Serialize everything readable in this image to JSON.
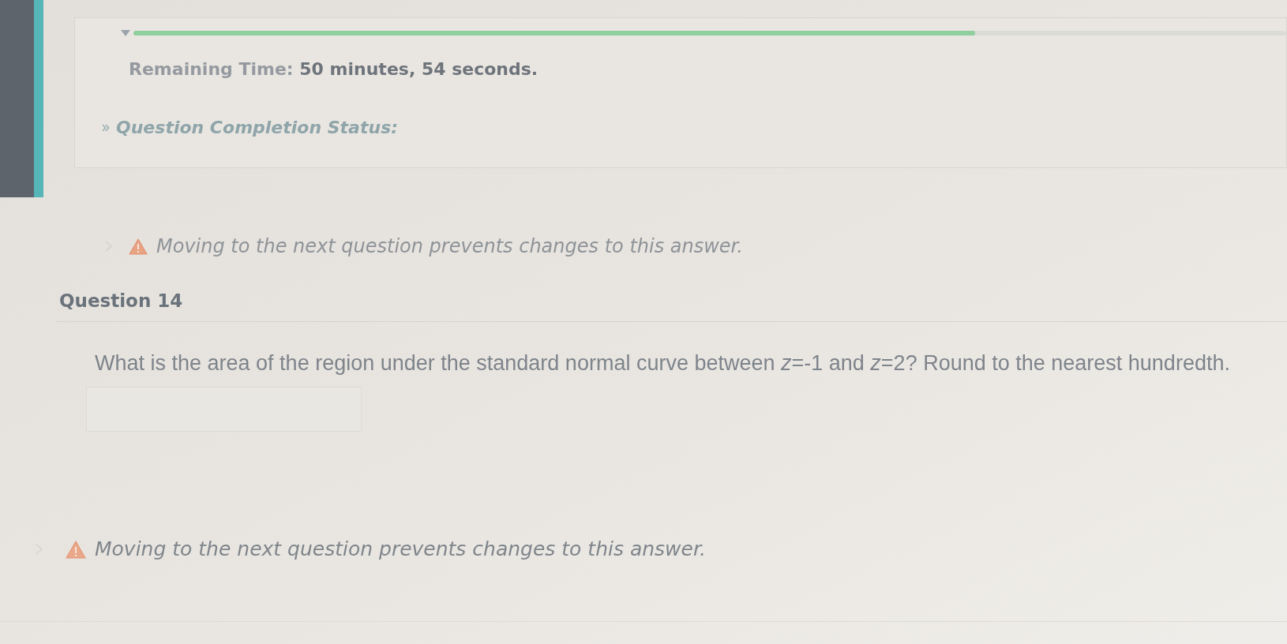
{
  "timer_panel": {
    "progress": {
      "level": 0.73
    },
    "remaining_time": "Remaining Time: **50 minutes, 54 seconds.**",
    "completion_status": "Question Completion Status:"
  },
  "warning_above": {
    "text": "Moving to the next question prevents changes to this answer."
  },
  "question": {
    "title": "Question 14",
    "text": "What is the area of the region under the standard normal curve between *z*=-1 and *z*=2? Round to the nearest hundredth."
  },
  "warning_below": {
    "text": "Moving to the next question prevents changes to this answer."
  }
}
